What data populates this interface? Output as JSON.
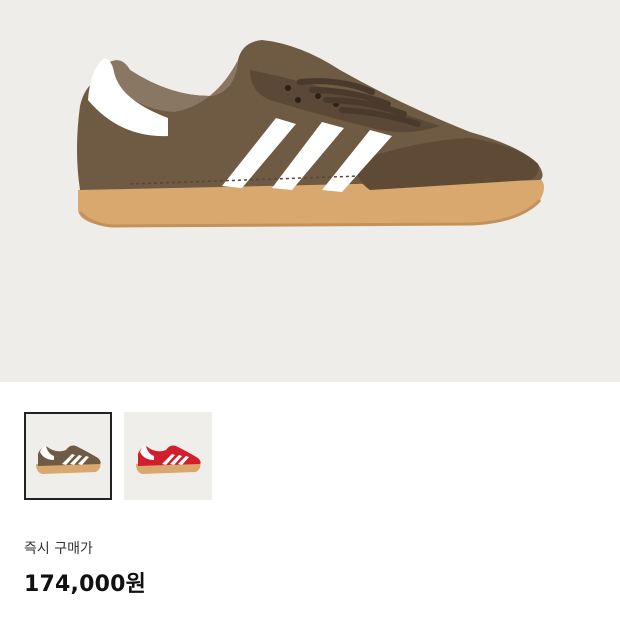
{
  "product": {
    "main_image_icon": "sneaker-brown-image",
    "thumbnails": [
      {
        "icon": "sneaker-brown-thumbnail",
        "selected": true,
        "colorway": "#6f5a43"
      },
      {
        "icon": "sneaker-red-thumbnail",
        "selected": false,
        "colorway": "#d11f2c"
      }
    ]
  },
  "pricing": {
    "label": "즉시 구매가",
    "price": "174,000원"
  },
  "colors": {
    "hero_bg": "#eeede9",
    "leather": "#6f5a43",
    "gum_sole": "#d9a86e",
    "stripe": "#ffffff"
  }
}
